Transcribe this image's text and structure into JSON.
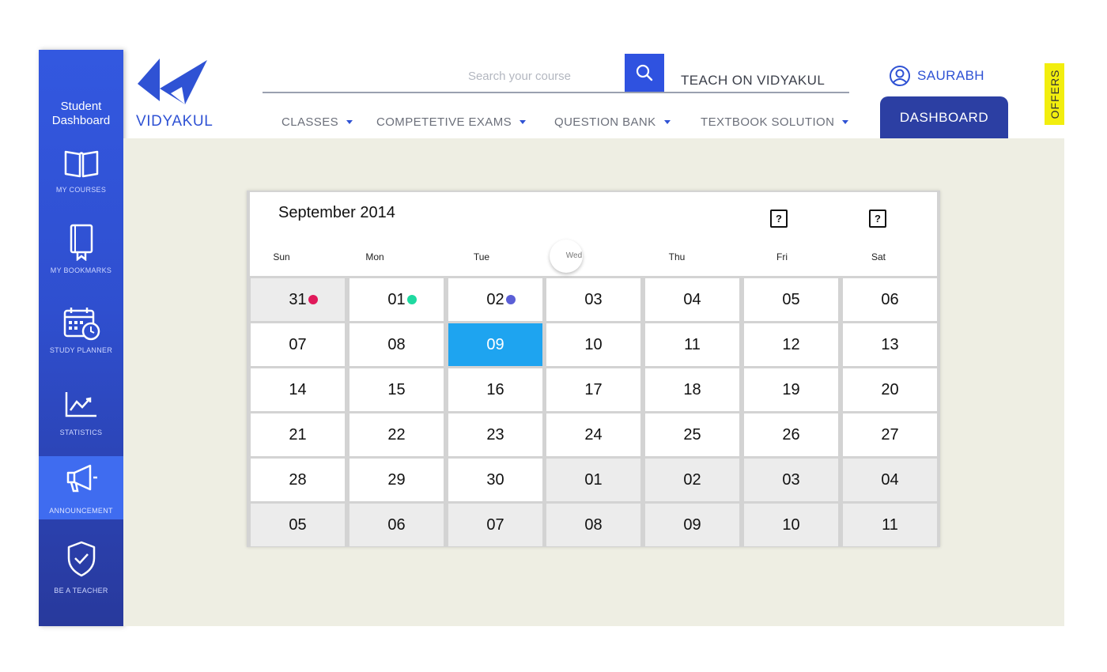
{
  "sidebar": {
    "title_line1": "Student",
    "title_line2": "Dashboard",
    "items": [
      {
        "label": "MY COURSES",
        "icon": "book-icon"
      },
      {
        "label": "MY BOOKMARKS",
        "icon": "bookmark-icon"
      },
      {
        "label": "STUDY PLANNER",
        "icon": "calendar-clock-icon"
      },
      {
        "label": "STATISTICS",
        "icon": "chart-icon"
      },
      {
        "label": "ANNOUNCEMENT",
        "icon": "megaphone-icon",
        "active": true
      },
      {
        "label": "BE A TEACHER",
        "icon": "shield-check-icon"
      }
    ]
  },
  "header": {
    "logo_text": "VIDYAKUL",
    "search_placeholder": "Search your course",
    "teach_link": "TEACH ON VIDYAKUL",
    "user_name": "SAURABH",
    "offers": "OFFERS",
    "nav": [
      "CLASSES",
      "COMPETETIVE EXAMS",
      "QUESTION BANK",
      "TEXTBOOK SOLUTION"
    ],
    "dashboard_tab": "DASHBOARD"
  },
  "calendar": {
    "month_title": "September 2014",
    "help_icons": [
      "?",
      "?"
    ],
    "weekdays": [
      "Sun",
      "Mon",
      "Tue",
      "Wed",
      "Thu",
      "Fri",
      "Sat"
    ],
    "weeks": [
      [
        "31",
        "01",
        "02",
        "03",
        "04",
        "05",
        "06"
      ],
      [
        "07",
        "08",
        "09",
        "10",
        "11",
        "12",
        "13"
      ],
      [
        "14",
        "15",
        "16",
        "17",
        "18",
        "19",
        "20"
      ],
      [
        "21",
        "22",
        "23",
        "24",
        "25",
        "26",
        "27"
      ],
      [
        "28",
        "29",
        "30",
        "01",
        "02",
        "03",
        "04"
      ],
      [
        "05",
        "06",
        "07",
        "08",
        "09",
        "10",
        "11"
      ]
    ],
    "muted_cells": [
      [
        0,
        0
      ],
      [
        4,
        3
      ],
      [
        4,
        4
      ],
      [
        4,
        5
      ],
      [
        4,
        6
      ],
      [
        5,
        0
      ],
      [
        5,
        1
      ],
      [
        5,
        2
      ],
      [
        5,
        3
      ],
      [
        5,
        4
      ],
      [
        5,
        5
      ],
      [
        5,
        6
      ]
    ],
    "selected_cell": [
      1,
      2
    ],
    "event_dots": [
      {
        "cell": [
          0,
          0
        ],
        "color": "#e0195a"
      },
      {
        "cell": [
          0,
          1
        ],
        "color": "#1ed9a0"
      },
      {
        "cell": [
          0,
          2
        ],
        "color": "#5b5fd6"
      }
    ],
    "colors": {
      "selected": "#1ea4f0",
      "brand": "#2f52d4"
    }
  }
}
